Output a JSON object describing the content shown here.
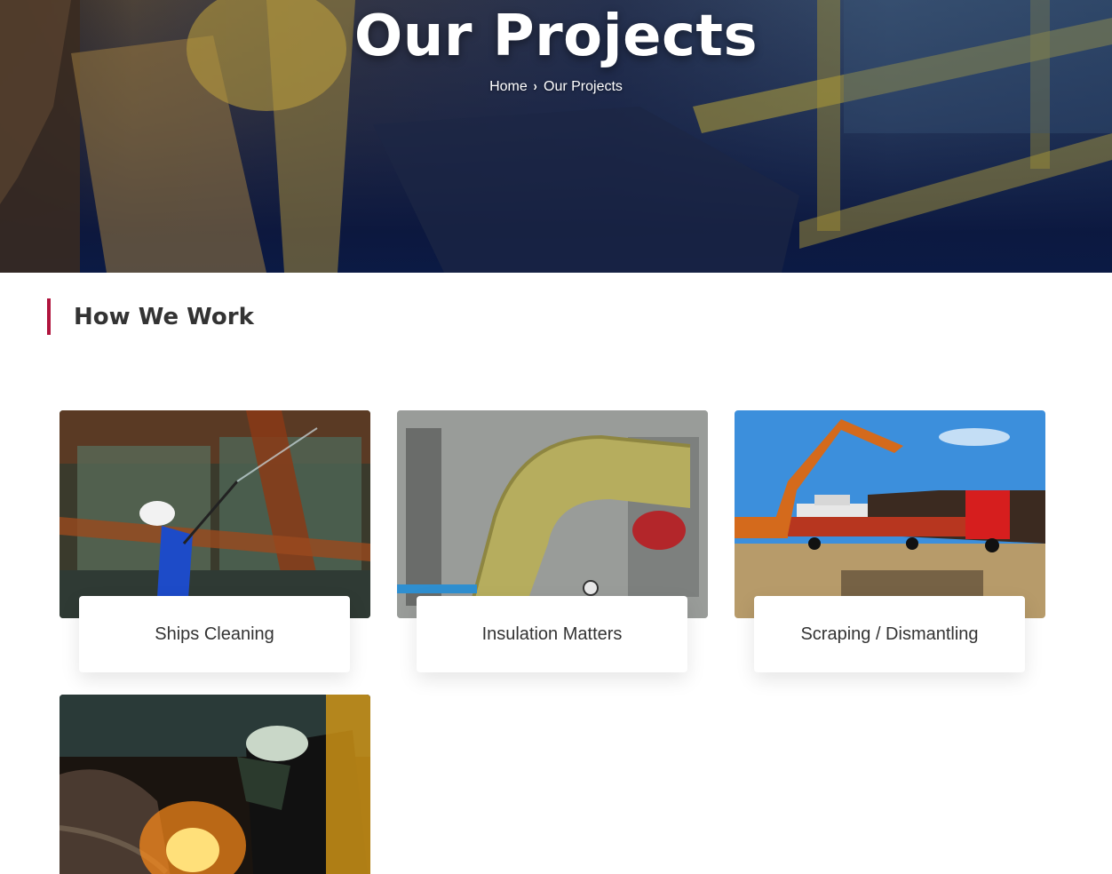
{
  "hero": {
    "title": "Our Projects",
    "breadcrumb": {
      "home": "Home",
      "separator": "›",
      "current": "Our Projects"
    }
  },
  "section": {
    "heading": "How We Work",
    "accent_color": "#b0143d"
  },
  "projects": [
    {
      "title": "Ships Cleaning"
    },
    {
      "title": "Insulation Matters"
    },
    {
      "title": "Scraping / Dismantling"
    },
    {
      "title": ""
    }
  ],
  "colors": {
    "hero_overlay": "#0b1a44",
    "heading_text": "#333333",
    "accent": "#b0143d"
  }
}
